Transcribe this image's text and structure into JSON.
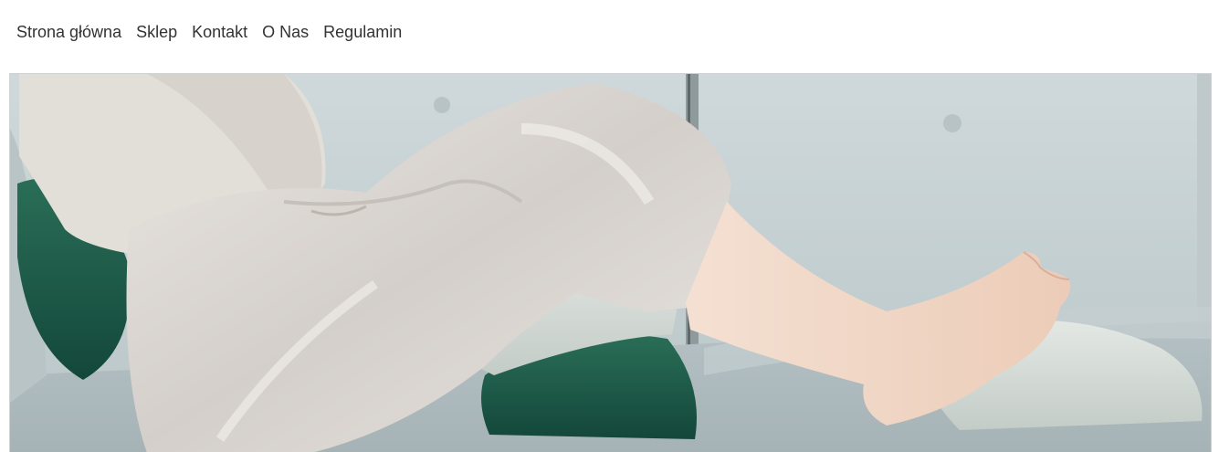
{
  "nav": {
    "items": [
      {
        "label": "Strona główna"
      },
      {
        "label": "Sklep"
      },
      {
        "label": "Kontakt"
      },
      {
        "label": "O Nas"
      },
      {
        "label": "Regulamin"
      }
    ]
  },
  "hero": {
    "image_description_icon": "hero-photo",
    "colors": {
      "sofa": "#c4cfd1",
      "pillow_green": "#1d5c47",
      "pillow_grey": "#d5dcd8",
      "pants": "#ddd8d3",
      "skin": "#f1d9c8"
    }
  }
}
